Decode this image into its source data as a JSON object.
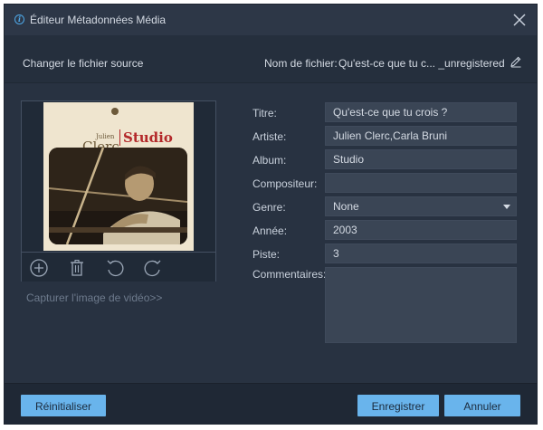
{
  "window": {
    "title": "Éditeur Métadonnées Média"
  },
  "toolbar": {
    "change_source_label": "Changer le fichier source",
    "filename_label": "Nom de fichier:",
    "filename_value": "Qu'est-ce que tu c... _unregistered.m"
  },
  "cover": {
    "artist_small": "Julien",
    "artist_big": "Clerc",
    "album_big": "Studio",
    "capture_label": "Capturer l'image de vidéo>>"
  },
  "form": {
    "title_label": "Titre:",
    "title_value": "Qu'est-ce que tu crois ?",
    "artist_label": "Artiste:",
    "artist_value": "Julien Clerc,Carla Bruni",
    "album_label": "Album:",
    "album_value": "Studio",
    "composer_label": "Compositeur:",
    "composer_value": "",
    "genre_label": "Genre:",
    "genre_value": "None",
    "year_label": "Année:",
    "year_value": "2003",
    "track_label": "Piste:",
    "track_value": "3",
    "comments_label": "Commentaires:",
    "comments_value": ""
  },
  "footer": {
    "reset_label": "Réinitialiser",
    "save_label": "Enregistrer",
    "cancel_label": "Annuler"
  },
  "colors": {
    "accent": "#69b4ec",
    "background": "#283241",
    "field": "#3a4555"
  }
}
